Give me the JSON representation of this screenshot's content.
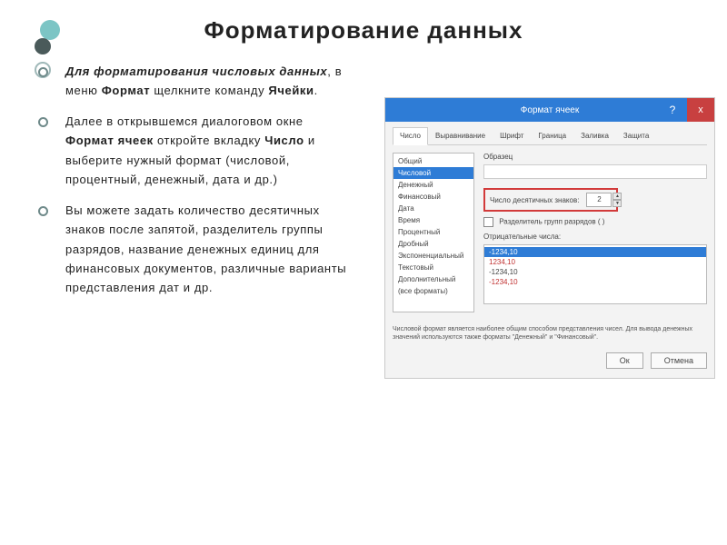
{
  "title": "Форматирование  данных",
  "bullets": {
    "b1_html": "<em><b>Для форматирования числовых данных</b></em>, в меню <b>Формат</b> щелкните команду <b>Ячейки</b>.",
    "b2_html": "Далее в открывшемся диалоговом окне <b>Формат ячеек</b> откройте вкладку <b>Число</b> и выберите нужный формат (числовой, процентный, денежный, дата и др.)",
    "b3_html": "Вы можете задать количество десятичных знаков после запятой, разделитель группы разрядов, название денежных единиц для финансовых документов, различные варианты представления дат и др."
  },
  "dialog": {
    "title": "Формат ячеек",
    "help": "?",
    "close": "x",
    "tabs": [
      "Число",
      "Выравнивание",
      "Шрифт",
      "Граница",
      "Заливка",
      "Защита"
    ],
    "active_tab": 0,
    "sample_label": "Образец",
    "categories": [
      "Общий",
      "Числовой",
      "Денежный",
      "Финансовый",
      "Дата",
      "Время",
      "Процентный",
      "Дробный",
      "Экспоненциальный",
      "Текстовый",
      "Дополнительный",
      "(все форматы)"
    ],
    "selected_category": 1,
    "decimal_label": "Число десятичных знаков:",
    "decimal_value": "2",
    "thousands_label": "Разделитель групп разрядов ( )",
    "neg_label": "Отрицательные числа:",
    "neg_samples": [
      "-1234,10",
      "1234,10",
      "-1234,10",
      "-1234,10"
    ],
    "neg_selected": 0,
    "description": "Числовой формат является наиболее общим способом представления чисел. Для вывода денежных значений используются также форматы \"Денежный\" и \"Финансовый\".",
    "ok": "Ок",
    "cancel": "Отмена"
  }
}
